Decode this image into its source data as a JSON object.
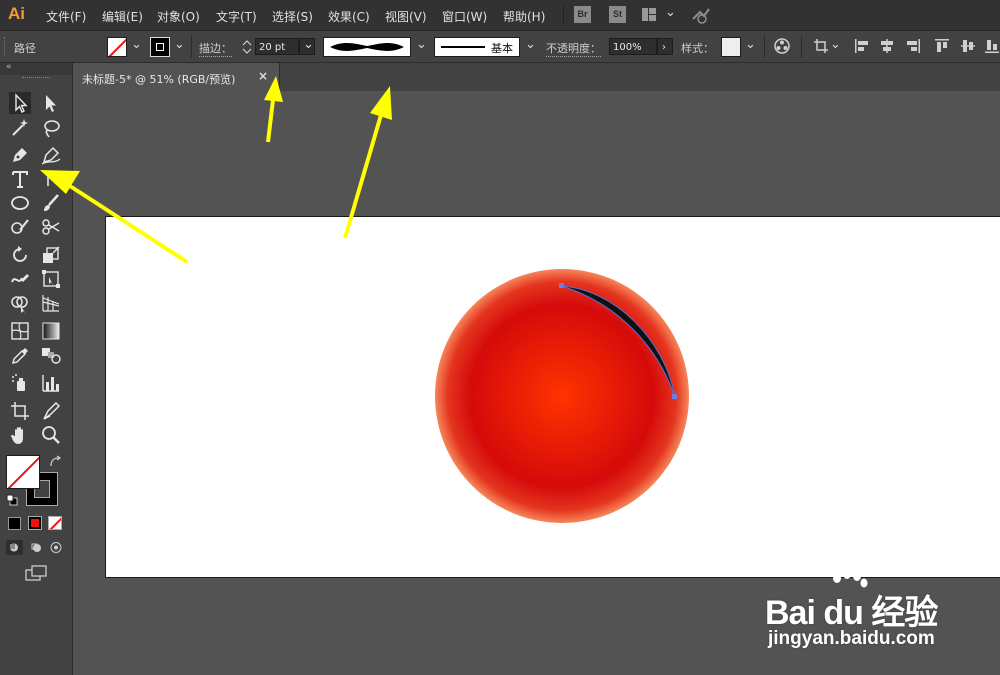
{
  "app": {
    "logo": "Ai"
  },
  "menu": [
    "文件(F)",
    "编辑(E)",
    "对象(O)",
    "文字(T)",
    "选择(S)",
    "效果(C)",
    "视图(V)",
    "窗口(W)",
    "帮助(H)"
  ],
  "app_icons": [
    "Br",
    "St"
  ],
  "control": {
    "object_type": "路径",
    "stroke_label": "描边：",
    "stroke_value": "20 pt",
    "stroke_style": "基本",
    "opacity_label": "不透明度：",
    "opacity_value": "100%",
    "style_label": "样式："
  },
  "document": {
    "tab_title": "未标题-5* @ 51% (RGB/预览)",
    "close": "×"
  },
  "watermark": {
    "logo": "Bai du 经验",
    "url": "jingyan.baidu.com"
  },
  "colors": {
    "menubar": "#323232",
    "panel": "#424242",
    "canvas": "#535353",
    "annotation": "#ffff00",
    "accent": "#f29a38"
  }
}
